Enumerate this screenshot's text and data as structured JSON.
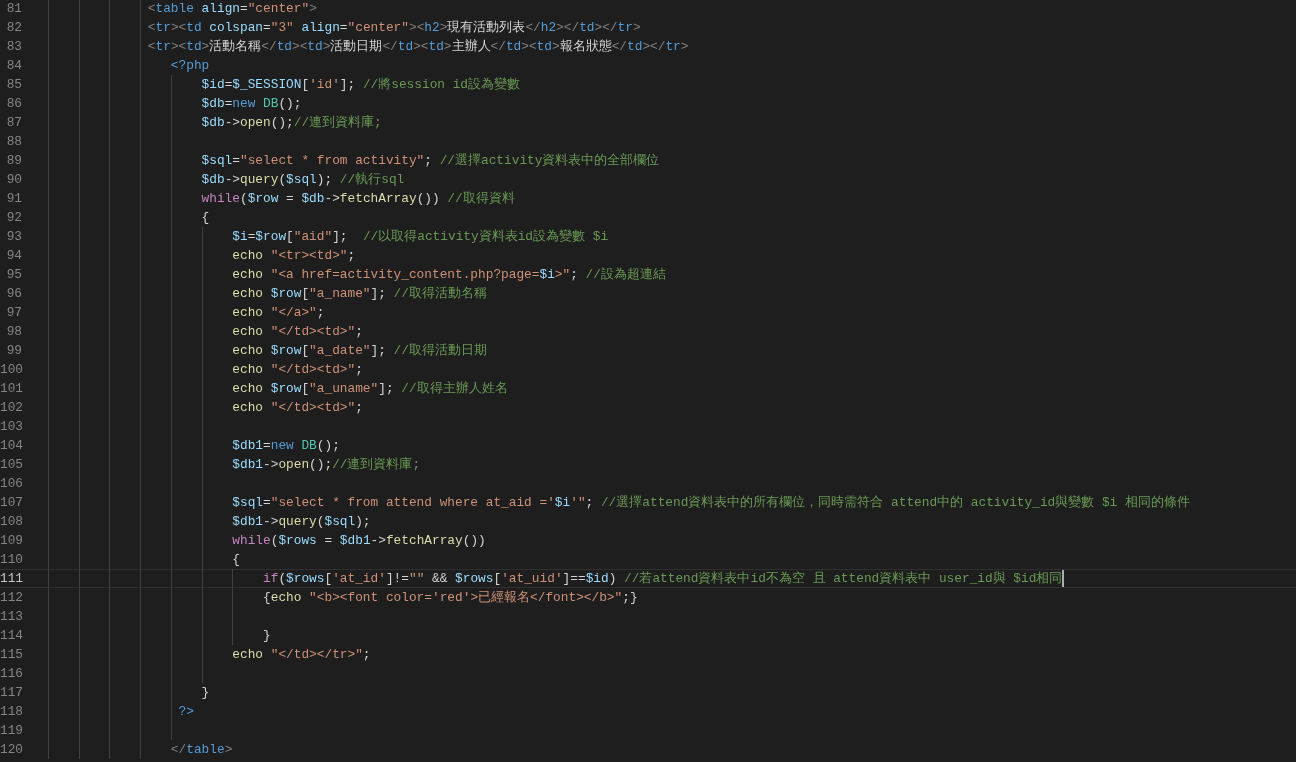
{
  "editor": {
    "lines": [
      {
        "number": "81",
        "current": false,
        "tokens": [
          {
            "kind": "br",
            "text": "             <"
          },
          {
            "kind": "tag",
            "text": "table "
          },
          {
            "kind": "attr",
            "text": "align"
          },
          {
            "kind": "txt",
            "text": "="
          },
          {
            "kind": "str",
            "text": "\"center\""
          },
          {
            "kind": "br",
            "text": ">"
          }
        ]
      },
      {
        "number": "82",
        "current": false,
        "tokens": [
          {
            "kind": "br",
            "text": "             <"
          },
          {
            "kind": "tag",
            "text": "tr"
          },
          {
            "kind": "br",
            "text": "><"
          },
          {
            "kind": "tag",
            "text": "td "
          },
          {
            "kind": "attr",
            "text": "colspan"
          },
          {
            "kind": "txt",
            "text": "="
          },
          {
            "kind": "str",
            "text": "\"3\" "
          },
          {
            "kind": "attr",
            "text": "align"
          },
          {
            "kind": "txt",
            "text": "="
          },
          {
            "kind": "str",
            "text": "\"center\""
          },
          {
            "kind": "br",
            "text": "><"
          },
          {
            "kind": "tag",
            "text": "h2"
          },
          {
            "kind": "br",
            "text": ">"
          },
          {
            "kind": "txt",
            "text": "現有活動列表"
          },
          {
            "kind": "br",
            "text": "</"
          },
          {
            "kind": "tag",
            "text": "h2"
          },
          {
            "kind": "br",
            "text": "></"
          },
          {
            "kind": "tag",
            "text": "td"
          },
          {
            "kind": "br",
            "text": "></"
          },
          {
            "kind": "tag",
            "text": "tr"
          },
          {
            "kind": "br",
            "text": ">"
          }
        ]
      },
      {
        "number": "83",
        "current": false,
        "tokens": [
          {
            "kind": "br",
            "text": "             <"
          },
          {
            "kind": "tag",
            "text": "tr"
          },
          {
            "kind": "br",
            "text": "><"
          },
          {
            "kind": "tag",
            "text": "td"
          },
          {
            "kind": "br",
            "text": ">"
          },
          {
            "kind": "txt",
            "text": "活動名稱"
          },
          {
            "kind": "br",
            "text": "</"
          },
          {
            "kind": "tag",
            "text": "td"
          },
          {
            "kind": "br",
            "text": "><"
          },
          {
            "kind": "tag",
            "text": "td"
          },
          {
            "kind": "br",
            "text": ">"
          },
          {
            "kind": "txt",
            "text": "活動日期"
          },
          {
            "kind": "br",
            "text": "</"
          },
          {
            "kind": "tag",
            "text": "td"
          },
          {
            "kind": "br",
            "text": "><"
          },
          {
            "kind": "tag",
            "text": "td"
          },
          {
            "kind": "br",
            "text": ">"
          },
          {
            "kind": "txt",
            "text": "主辦人"
          },
          {
            "kind": "br",
            "text": "</"
          },
          {
            "kind": "tag",
            "text": "td"
          },
          {
            "kind": "br",
            "text": "><"
          },
          {
            "kind": "tag",
            "text": "td"
          },
          {
            "kind": "br",
            "text": ">"
          },
          {
            "kind": "txt",
            "text": "報名狀態"
          },
          {
            "kind": "br",
            "text": "</"
          },
          {
            "kind": "tag",
            "text": "td"
          },
          {
            "kind": "br",
            "text": "></"
          },
          {
            "kind": "tag",
            "text": "tr"
          },
          {
            "kind": "br",
            "text": ">"
          }
        ]
      },
      {
        "number": "84",
        "current": false,
        "tokens": [
          {
            "kind": "kw",
            "text": "                <?php"
          }
        ]
      },
      {
        "number": "85",
        "current": false,
        "tokens": [
          {
            "kind": "var",
            "text": "                    $id"
          },
          {
            "kind": "txt",
            "text": "="
          },
          {
            "kind": "var",
            "text": "$_SESSION"
          },
          {
            "kind": "txt",
            "text": "["
          },
          {
            "kind": "str",
            "text": "'id'"
          },
          {
            "kind": "txt",
            "text": "]; "
          },
          {
            "kind": "cm",
            "text": "//將session id設為變數"
          }
        ]
      },
      {
        "number": "86",
        "current": false,
        "tokens": [
          {
            "kind": "var",
            "text": "                    $db"
          },
          {
            "kind": "txt",
            "text": "="
          },
          {
            "kind": "kw",
            "text": "new "
          },
          {
            "kind": "cls",
            "text": "DB"
          },
          {
            "kind": "txt",
            "text": "();"
          }
        ]
      },
      {
        "number": "87",
        "current": false,
        "tokens": [
          {
            "kind": "var",
            "text": "                    $db"
          },
          {
            "kind": "txt",
            "text": "->"
          },
          {
            "kind": "fn",
            "text": "open"
          },
          {
            "kind": "txt",
            "text": "();"
          },
          {
            "kind": "cm",
            "text": "//連到資料庫;"
          }
        ]
      },
      {
        "number": "88",
        "current": false
      },
      {
        "number": "89",
        "current": false,
        "tokens": [
          {
            "kind": "var",
            "text": "                    $sql"
          },
          {
            "kind": "txt",
            "text": "="
          },
          {
            "kind": "str",
            "text": "\"select * from activity\""
          },
          {
            "kind": "txt",
            "text": "; "
          },
          {
            "kind": "cm",
            "text": "//選擇activity資料表中的全部欄位"
          }
        ]
      },
      {
        "number": "90",
        "current": false,
        "tokens": [
          {
            "kind": "var",
            "text": "                    $db"
          },
          {
            "kind": "txt",
            "text": "->"
          },
          {
            "kind": "fn",
            "text": "query"
          },
          {
            "kind": "txt",
            "text": "("
          },
          {
            "kind": "var",
            "text": "$sql"
          },
          {
            "kind": "txt",
            "text": "); "
          },
          {
            "kind": "cm",
            "text": "//執行sql"
          }
        ]
      },
      {
        "number": "91",
        "current": false,
        "tokens": [
          {
            "kind": "ctrl",
            "text": "                    while"
          },
          {
            "kind": "txt",
            "text": "("
          },
          {
            "kind": "var",
            "text": "$row"
          },
          {
            "kind": "txt",
            "text": " = "
          },
          {
            "kind": "var",
            "text": "$db"
          },
          {
            "kind": "txt",
            "text": "->"
          },
          {
            "kind": "fn",
            "text": "fetchArray"
          },
          {
            "kind": "txt",
            "text": "()) "
          },
          {
            "kind": "cm",
            "text": "//取得資料"
          }
        ]
      },
      {
        "number": "92",
        "current": false,
        "tokens": [
          {
            "kind": "txt",
            "text": "                    {"
          }
        ]
      },
      {
        "number": "93",
        "current": false,
        "tokens": [
          {
            "kind": "var",
            "text": "                        $i"
          },
          {
            "kind": "txt",
            "text": "="
          },
          {
            "kind": "var",
            "text": "$row"
          },
          {
            "kind": "txt",
            "text": "["
          },
          {
            "kind": "str",
            "text": "\"aid\""
          },
          {
            "kind": "txt",
            "text": "];  "
          },
          {
            "kind": "cm",
            "text": "//以取得activity資料表id設為變數 $i"
          }
        ]
      },
      {
        "number": "94",
        "current": false,
        "tokens": [
          {
            "kind": "fn",
            "text": "                        echo "
          },
          {
            "kind": "str",
            "text": "\"<tr><td>\""
          },
          {
            "kind": "txt",
            "text": ";"
          }
        ]
      },
      {
        "number": "95",
        "current": false,
        "tokens": [
          {
            "kind": "fn",
            "text": "                        echo "
          },
          {
            "kind": "str",
            "text": "\"<a href=activity_content.php?page="
          },
          {
            "kind": "var",
            "text": "$i"
          },
          {
            "kind": "str",
            "text": ">\""
          },
          {
            "kind": "txt",
            "text": "; "
          },
          {
            "kind": "cm",
            "text": "//設為超連結"
          }
        ]
      },
      {
        "number": "96",
        "current": false,
        "tokens": [
          {
            "kind": "fn",
            "text": "                        echo "
          },
          {
            "kind": "var",
            "text": "$row"
          },
          {
            "kind": "txt",
            "text": "["
          },
          {
            "kind": "str",
            "text": "\"a_name\""
          },
          {
            "kind": "txt",
            "text": "]; "
          },
          {
            "kind": "cm",
            "text": "//取得活動名稱"
          }
        ]
      },
      {
        "number": "97",
        "current": false,
        "tokens": [
          {
            "kind": "fn",
            "text": "                        echo "
          },
          {
            "kind": "str",
            "text": "\"</a>\""
          },
          {
            "kind": "txt",
            "text": ";"
          }
        ]
      },
      {
        "number": "98",
        "current": false,
        "tokens": [
          {
            "kind": "fn",
            "text": "                        echo "
          },
          {
            "kind": "str",
            "text": "\"</td><td>\""
          },
          {
            "kind": "txt",
            "text": ";"
          }
        ]
      },
      {
        "number": "99",
        "current": false,
        "tokens": [
          {
            "kind": "fn",
            "text": "                        echo "
          },
          {
            "kind": "var",
            "text": "$row"
          },
          {
            "kind": "txt",
            "text": "["
          },
          {
            "kind": "str",
            "text": "\"a_date\""
          },
          {
            "kind": "txt",
            "text": "]; "
          },
          {
            "kind": "cm",
            "text": "//取得活動日期"
          }
        ]
      },
      {
        "number": "100",
        "current": false,
        "tokens": [
          {
            "kind": "fn",
            "text": "                        echo "
          },
          {
            "kind": "str",
            "text": "\"</td><td>\""
          },
          {
            "kind": "txt",
            "text": ";"
          }
        ]
      },
      {
        "number": "101",
        "current": false,
        "tokens": [
          {
            "kind": "fn",
            "text": "                        echo "
          },
          {
            "kind": "var",
            "text": "$row"
          },
          {
            "kind": "txt",
            "text": "["
          },
          {
            "kind": "str",
            "text": "\"a_uname\""
          },
          {
            "kind": "txt",
            "text": "]; "
          },
          {
            "kind": "cm",
            "text": "//取得主辦人姓名"
          }
        ]
      },
      {
        "number": "102",
        "current": false,
        "tokens": [
          {
            "kind": "fn",
            "text": "                        echo "
          },
          {
            "kind": "str",
            "text": "\"</td><td>\""
          },
          {
            "kind": "txt",
            "text": ";"
          }
        ]
      },
      {
        "number": "103",
        "current": false
      },
      {
        "number": "104",
        "current": false,
        "tokens": [
          {
            "kind": "var",
            "text": "                        $db1"
          },
          {
            "kind": "txt",
            "text": "="
          },
          {
            "kind": "kw",
            "text": "new "
          },
          {
            "kind": "cls",
            "text": "DB"
          },
          {
            "kind": "txt",
            "text": "();"
          }
        ]
      },
      {
        "number": "105",
        "current": false,
        "tokens": [
          {
            "kind": "var",
            "text": "                        $db1"
          },
          {
            "kind": "txt",
            "text": "->"
          },
          {
            "kind": "fn",
            "text": "open"
          },
          {
            "kind": "txt",
            "text": "();"
          },
          {
            "kind": "cm",
            "text": "//連到資料庫;"
          }
        ]
      },
      {
        "number": "106",
        "current": false
      },
      {
        "number": "107",
        "current": false,
        "tokens": [
          {
            "kind": "var",
            "text": "                        $sql"
          },
          {
            "kind": "txt",
            "text": "="
          },
          {
            "kind": "str",
            "text": "\"select * from attend where at_aid ='"
          },
          {
            "kind": "var",
            "text": "$i"
          },
          {
            "kind": "str",
            "text": "'\""
          },
          {
            "kind": "txt",
            "text": "; "
          },
          {
            "kind": "cm",
            "text": "//選擇attend資料表中的所有欄位，同時需符合 attend中的 activity_id與變數 $i 相同的條件"
          }
        ]
      },
      {
        "number": "108",
        "current": false,
        "tokens": [
          {
            "kind": "var",
            "text": "                        $db1"
          },
          {
            "kind": "txt",
            "text": "->"
          },
          {
            "kind": "fn",
            "text": "query"
          },
          {
            "kind": "txt",
            "text": "("
          },
          {
            "kind": "var",
            "text": "$sql"
          },
          {
            "kind": "txt",
            "text": ");"
          }
        ]
      },
      {
        "number": "109",
        "current": false,
        "tokens": [
          {
            "kind": "ctrl",
            "text": "                        while"
          },
          {
            "kind": "txt",
            "text": "("
          },
          {
            "kind": "var",
            "text": "$rows"
          },
          {
            "kind": "txt",
            "text": " = "
          },
          {
            "kind": "var",
            "text": "$db1"
          },
          {
            "kind": "txt",
            "text": "->"
          },
          {
            "kind": "fn",
            "text": "fetchArray"
          },
          {
            "kind": "txt",
            "text": "())"
          }
        ]
      },
      {
        "number": "110",
        "current": false,
        "tokens": [
          {
            "kind": "txt",
            "text": "                        {"
          }
        ]
      },
      {
        "number": "111",
        "current": true,
        "tokens": [
          {
            "kind": "ctrl",
            "text": "                            if"
          },
          {
            "kind": "txt",
            "text": "("
          },
          {
            "kind": "var",
            "text": "$rows"
          },
          {
            "kind": "txt",
            "text": "["
          },
          {
            "kind": "str",
            "text": "'at_id'"
          },
          {
            "kind": "txt",
            "text": "]!="
          },
          {
            "kind": "str",
            "text": "\"\""
          },
          {
            "kind": "txt",
            "text": " && "
          },
          {
            "kind": "var",
            "text": "$rows"
          },
          {
            "kind": "txt",
            "text": "["
          },
          {
            "kind": "str",
            "text": "'at_uid'"
          },
          {
            "kind": "txt",
            "text": "]=="
          },
          {
            "kind": "var",
            "text": "$id"
          },
          {
            "kind": "txt",
            "text": ") "
          },
          {
            "kind": "cm",
            "text": "//若attend資料表中id不為空 且 attend資料表中 user_id與 $id相同"
          }
        ]
      },
      {
        "number": "112",
        "current": false,
        "tokens": [
          {
            "kind": "txt",
            "text": "                            {"
          },
          {
            "kind": "fn",
            "text": "echo "
          },
          {
            "kind": "str",
            "text": "\"<b><font color='red'>已經報名</font></b>\""
          },
          {
            "kind": "txt",
            "text": ";}"
          }
        ]
      },
      {
        "number": "113",
        "current": false
      },
      {
        "number": "114",
        "current": false,
        "tokens": [
          {
            "kind": "txt",
            "text": "                            }"
          }
        ]
      },
      {
        "number": "115",
        "current": false,
        "tokens": [
          {
            "kind": "fn",
            "text": "                        echo "
          },
          {
            "kind": "str",
            "text": "\"</td></tr>\""
          },
          {
            "kind": "txt",
            "text": ";"
          }
        ]
      },
      {
        "number": "116",
        "current": false
      },
      {
        "number": "117",
        "current": false,
        "tokens": [
          {
            "kind": "txt",
            "text": "                    }"
          }
        ]
      },
      {
        "number": "118",
        "current": false,
        "tokens": [
          {
            "kind": "kw",
            "text": "                 ?>"
          }
        ]
      },
      {
        "number": "119",
        "current": false
      },
      {
        "number": "120",
        "current": false,
        "tokens": [
          {
            "kind": "br",
            "text": "                </"
          },
          {
            "kind": "tag",
            "text": "table"
          },
          {
            "kind": "br",
            "text": ">"
          }
        ]
      }
    ]
  }
}
